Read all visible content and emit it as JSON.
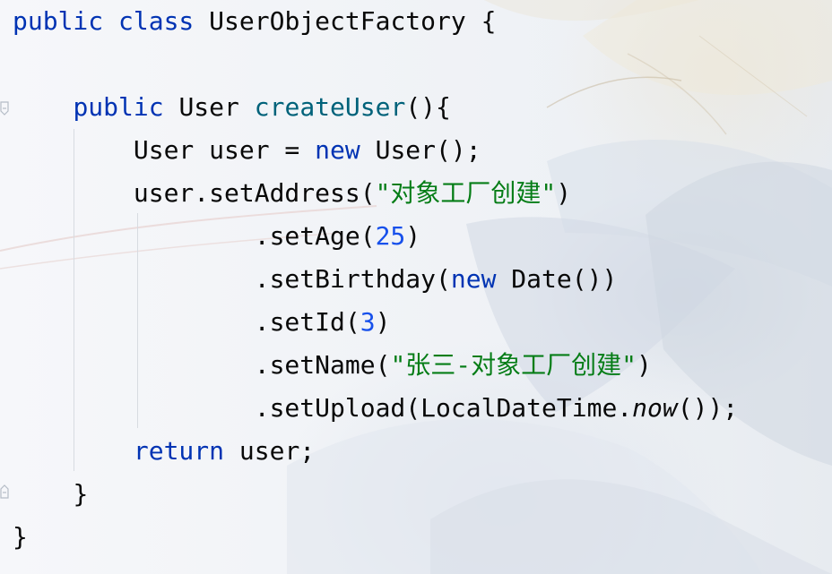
{
  "code_lines": [
    {
      "indent": "",
      "parts": [
        {
          "text": "public class",
          "kind": "keyword"
        },
        {
          "text": " UserObjectFactory {",
          "kind": "plain"
        }
      ]
    },
    {
      "indent": "",
      "parts": []
    },
    {
      "indent": "    ",
      "parts": [
        {
          "text": "public",
          "kind": "keyword"
        },
        {
          "text": " User ",
          "kind": "plain"
        },
        {
          "text": "createUser",
          "kind": "method"
        },
        {
          "text": "(){",
          "kind": "plain"
        }
      ]
    },
    {
      "indent": "        ",
      "parts": [
        {
          "text": "User user = ",
          "kind": "plain"
        },
        {
          "text": "new",
          "kind": "keyword"
        },
        {
          "text": " User();",
          "kind": "plain"
        }
      ]
    },
    {
      "indent": "        ",
      "parts": [
        {
          "text": "user.setAddress(",
          "kind": "plain"
        },
        {
          "text": "\"对象工厂创建\"",
          "kind": "string"
        },
        {
          "text": ")",
          "kind": "plain"
        }
      ]
    },
    {
      "indent": "                ",
      "parts": [
        {
          "text": ".setAge(",
          "kind": "plain"
        },
        {
          "text": "25",
          "kind": "number"
        },
        {
          "text": ")",
          "kind": "plain"
        }
      ]
    },
    {
      "indent": "                ",
      "parts": [
        {
          "text": ".setBirthday(",
          "kind": "plain"
        },
        {
          "text": "new",
          "kind": "keyword"
        },
        {
          "text": " Date())",
          "kind": "plain"
        }
      ]
    },
    {
      "indent": "                ",
      "parts": [
        {
          "text": ".setId(",
          "kind": "plain"
        },
        {
          "text": "3",
          "kind": "number"
        },
        {
          "text": ")",
          "kind": "plain"
        }
      ]
    },
    {
      "indent": "                ",
      "parts": [
        {
          "text": ".setName(",
          "kind": "plain"
        },
        {
          "text": "\"张三-对象工厂创建\"",
          "kind": "string"
        },
        {
          "text": ")",
          "kind": "plain"
        }
      ]
    },
    {
      "indent": "                ",
      "parts": [
        {
          "text": ".setUpload(LocalDateTime.",
          "kind": "plain"
        },
        {
          "text": "now",
          "kind": "italic"
        },
        {
          "text": "());",
          "kind": "plain"
        }
      ]
    },
    {
      "indent": "        ",
      "parts": [
        {
          "text": "return",
          "kind": "keyword"
        },
        {
          "text": " user;",
          "kind": "plain"
        }
      ]
    },
    {
      "indent": "    ",
      "parts": [
        {
          "text": "}",
          "kind": "plain"
        }
      ]
    },
    {
      "indent": "",
      "parts": [
        {
          "text": "}",
          "kind": "plain"
        }
      ]
    }
  ],
  "syntax_colors": {
    "keyword": "#0033b3",
    "method": "#00627a",
    "string": "#067d17",
    "number": "#1750eb",
    "plain": "#080808"
  },
  "gutter_icons": [
    "fold-start-icon",
    "fold-end-icon"
  ]
}
